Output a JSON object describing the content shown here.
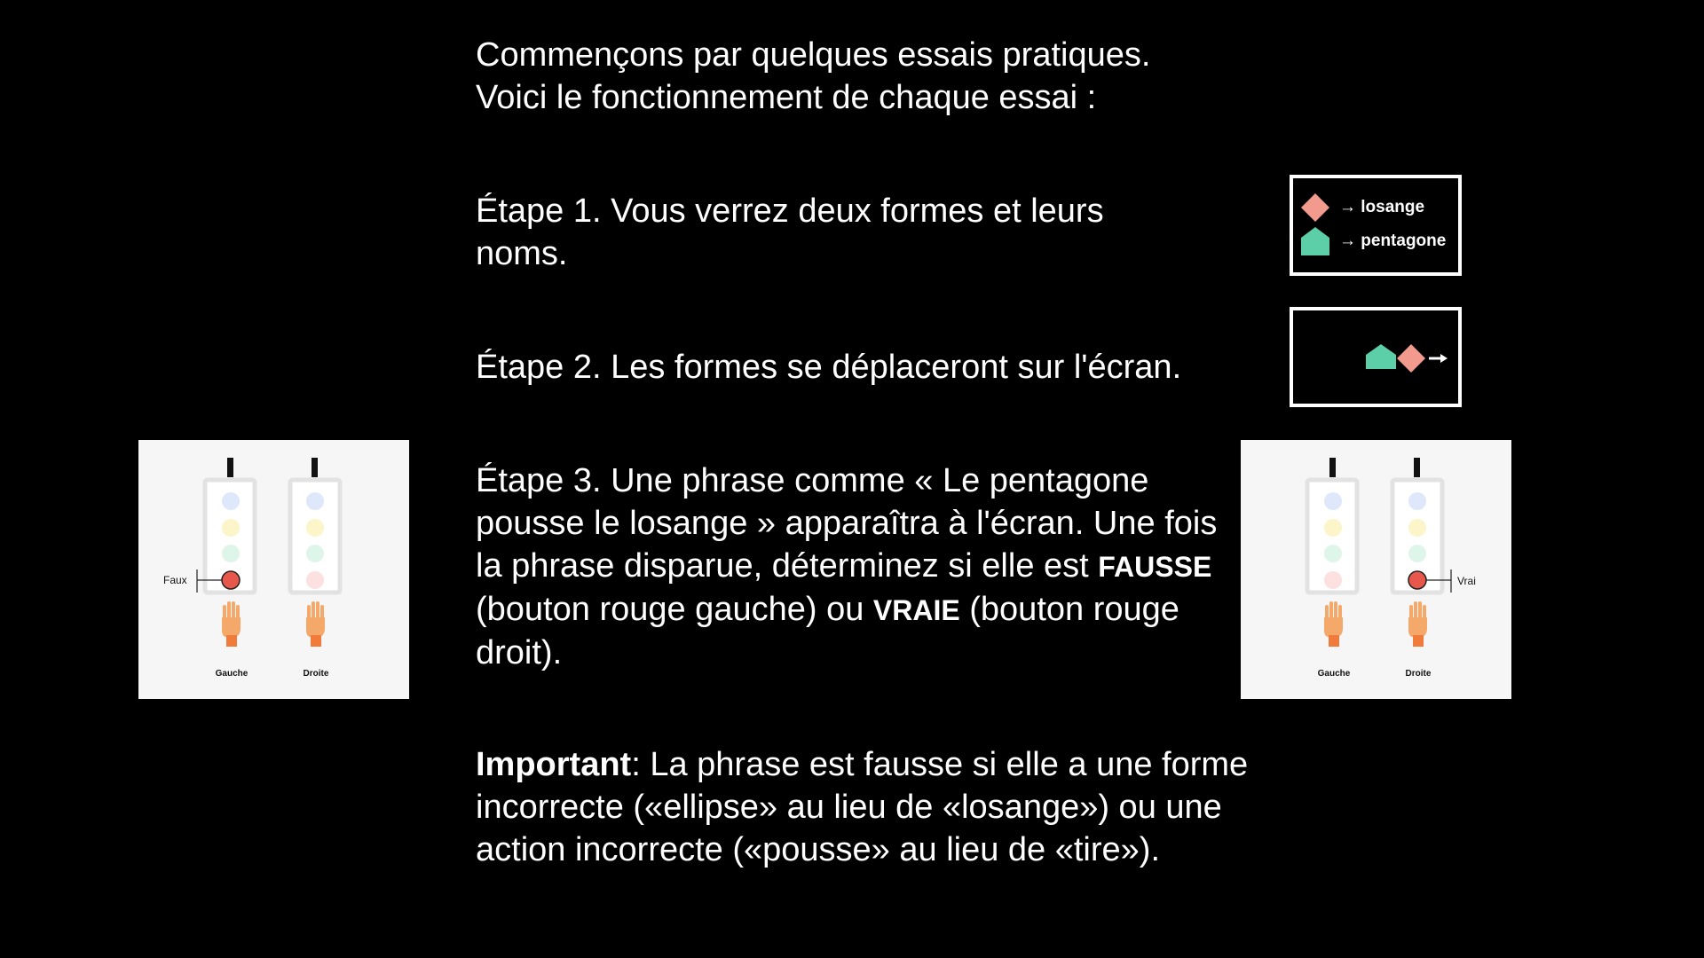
{
  "intro": {
    "line1": "Commençons par quelques essais pratiques.",
    "line2": "Voici le fonctionnement de chaque essai :"
  },
  "step1": {
    "text": "Étape 1. Vous verrez deux formes et leurs noms."
  },
  "step2": {
    "text": "Étape 2. Les formes se déplaceront sur l'écran."
  },
  "step3": {
    "text_a": "Étape 3. Une phrase comme « Le pentagone pousse le losange » apparaîtra à l'écran. Une fois la phrase disparue, déterminez si elle est ",
    "false_word": "FAUSSE",
    "text_b": " (bouton rouge gauche) ou ",
    "true_word": "VRAIE",
    "text_c": " (bouton rouge droit)."
  },
  "important": {
    "label": "Important",
    "text": ": La phrase est fausse si elle a une forme incorrecte («ellipse» au lieu de «losange») ou une action incorrecte («pousse» au lieu de «tire»)."
  },
  "legend": {
    "diamond_label": "→ losange",
    "pentagon_label": "→ pentagone"
  },
  "panels": {
    "left_hand": "Gauche",
    "right_hand": "Droite",
    "false_label": "Faux",
    "true_label": "Vrai"
  },
  "colors": {
    "diamond": "#f29a8e",
    "pentagon": "#5ccfa8",
    "red_button": "#e8574c",
    "hand": "#f4a86a"
  }
}
